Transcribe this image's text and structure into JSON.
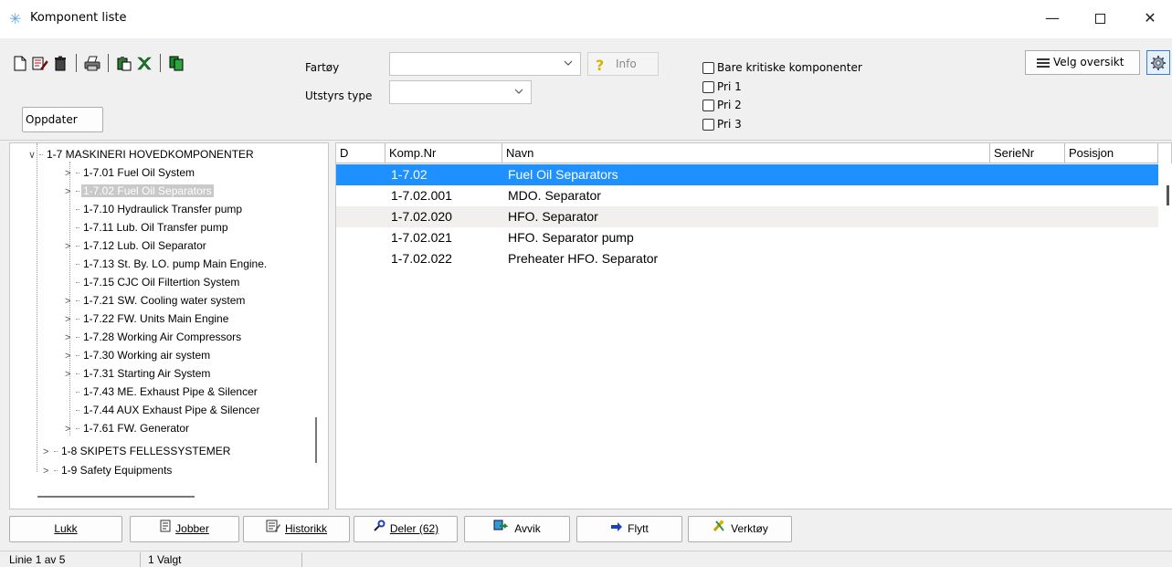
{
  "window": {
    "title": "Komponent liste",
    "minimize": "—",
    "close": "✕"
  },
  "filters": {
    "fartoy_label": "Fartøy",
    "fartoy_value": "",
    "utstyrs_label": "Utstyrs type",
    "utstyrs_value": "",
    "info_label": "Info",
    "oppdater_label": "Oppdater",
    "checkboxes": [
      {
        "label": "Bare kritiske komponenter",
        "checked": false
      },
      {
        "label": "Pri 1",
        "checked": false
      },
      {
        "label": "Pri 2",
        "checked": false
      },
      {
        "label": "Pri 3",
        "checked": false
      }
    ],
    "velg_oversikt_label": "Velg oversikt"
  },
  "tree": {
    "items": [
      {
        "label": "1-7 MASKINERI HOVEDKOMPONENTER",
        "expander": "∨",
        "level": 1
      },
      {
        "label": "1-7.01 Fuel Oil System",
        "expander": ">",
        "level": 2
      },
      {
        "label": "1-7.02 Fuel Oil Separators",
        "expander": ">",
        "level": 2,
        "selected": true
      },
      {
        "label": "1-7.10 Hydraulick Transfer pump",
        "expander": "",
        "level": 2
      },
      {
        "label": "1-7.11 Lub. Oil  Transfer pump",
        "expander": "",
        "level": 2
      },
      {
        "label": "1-7.12 Lub. Oil Separator",
        "expander": ">",
        "level": 2
      },
      {
        "label": "1-7.13 St. By. LO. pump Main Engine.",
        "expander": "",
        "level": 2
      },
      {
        "label": "1-7.15 CJC Oil Filtertion System",
        "expander": "",
        "level": 2
      },
      {
        "label": "1-7.21 SW. Cooling water system",
        "expander": ">",
        "level": 2
      },
      {
        "label": "1-7.22 FW. Units Main Engine",
        "expander": ">",
        "level": 2
      },
      {
        "label": "1-7.28 Working Air Compressors",
        "expander": ">",
        "level": 2
      },
      {
        "label": "1-7.30 Working air system",
        "expander": ">",
        "level": 2
      },
      {
        "label": "1-7.31 Starting Air System",
        "expander": ">",
        "level": 2
      },
      {
        "label": "1-7.43 ME. Exhaust Pipe & Silencer",
        "expander": "",
        "level": 2
      },
      {
        "label": "1-7.44 AUX Exhaust Pipe & Silencer",
        "expander": "",
        "level": 2
      },
      {
        "label": "1-7.61 FW. Generator",
        "expander": ">",
        "level": 2
      },
      {
        "label": "1-8 SKIPETS FELLESSYSTEMER",
        "expander": ">",
        "level": 1
      },
      {
        "label": "1-9 Safety Equipments",
        "expander": ">",
        "level": 1
      }
    ]
  },
  "grid": {
    "columns": [
      "D",
      "Komp.Nr",
      "Navn",
      "SerieNr",
      "Posisjon"
    ],
    "rows": [
      {
        "d": "",
        "komp": "1-7.02",
        "navn": "Fuel Oil Separators",
        "serie": "",
        "pos": ""
      },
      {
        "d": "",
        "komp": "1-7.02.001",
        "navn": "MDO. Separator",
        "serie": "",
        "pos": ""
      },
      {
        "d": "",
        "komp": "1-7.02.020",
        "navn": "HFO. Separator",
        "serie": "",
        "pos": ""
      },
      {
        "d": "",
        "komp": "1-7.02.021",
        "navn": "HFO. Separator pump",
        "serie": "",
        "pos": ""
      },
      {
        "d": "",
        "komp": "1-7.02.022",
        "navn": "Preheater HFO. Separator",
        "serie": "",
        "pos": ""
      }
    ]
  },
  "buttons": {
    "lukk": "Lukk",
    "jobber": "Jobber",
    "historikk": "Historikk",
    "deler": "Deler (62)",
    "avvik": "Avvik",
    "flytt": "Flytt",
    "verktoy": "Verktøy"
  },
  "status": {
    "line": "Linie 1 av 5",
    "selected": "1 Valgt"
  },
  "colors": {
    "selection": "#1e90ff",
    "alt_row": "#f2f0ed"
  }
}
